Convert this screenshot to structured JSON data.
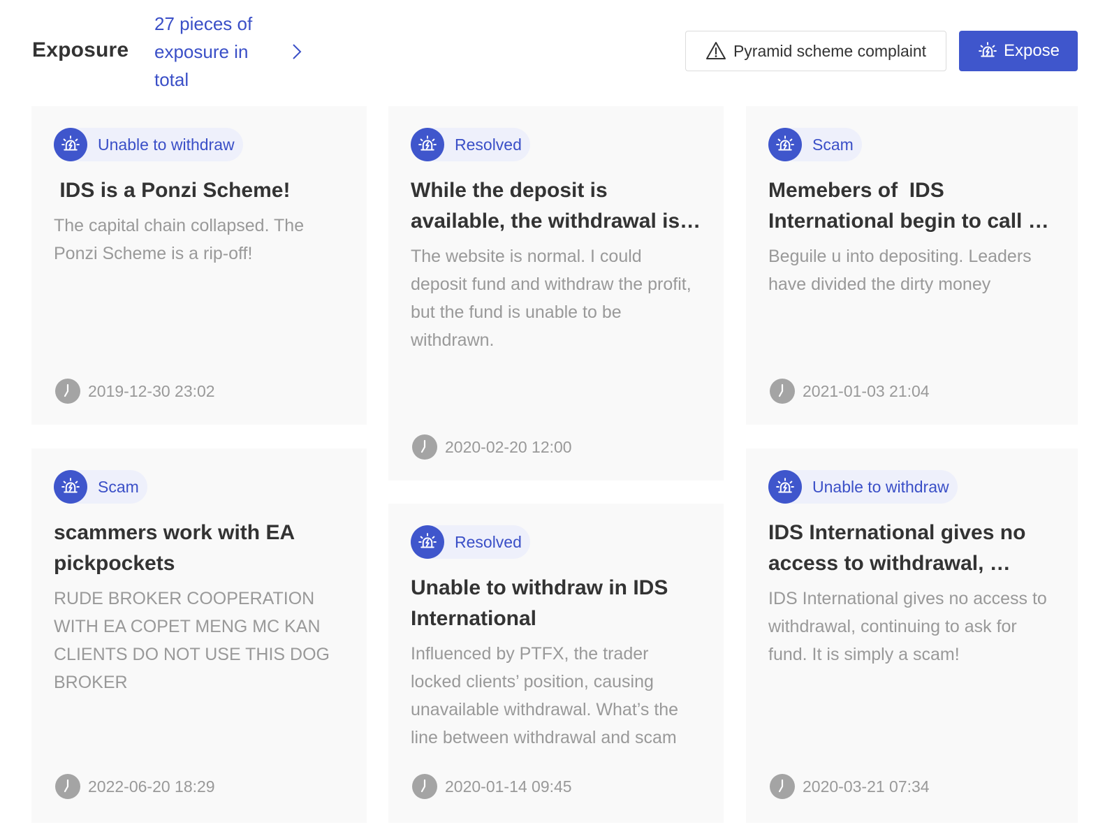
{
  "header": {
    "title": "Exposure",
    "count_text": "27 pieces of exposure in total",
    "complaint_label": "Pyramid scheme complaint",
    "expose_label": "Expose"
  },
  "colors": {
    "accent": "#3f56cc",
    "tag_background": "#eef0fb",
    "card_background": "#f9f9f9",
    "title_text": "#333333",
    "muted_text": "#999999"
  },
  "icons": {
    "tag": "alarm-siren-icon",
    "complaint": "warning-triangle-icon",
    "expose": "alarm-siren-icon",
    "time": "clock-icon",
    "more": "chevron-right-icon"
  },
  "cards": [
    {
      "tag": "Unable to withdraw",
      "title": " IDS is a Ponzi Scheme!",
      "description": "The capital chain collapsed. The Ponzi Scheme is a rip-off!",
      "time": "2019-12-30 23:02"
    },
    {
      "tag": "Resolved",
      "title": "While the deposit is available, the withdrawal is not",
      "description": "The website is normal. I could deposit fund and withdraw the profit, but the fund is unable to be withdrawn.",
      "time": "2020-02-20 12:00"
    },
    {
      "tag": "Scam",
      "title": "Memebers of  IDS International begin to call you",
      "description": "Beguile u into depositing. Leaders have divided the dirty money",
      "time": "2021-01-03 21:04"
    },
    {
      "tag": "Scam",
      "title": "scammers work with EA pickpockets",
      "description": "RUDE BROKER COOPERATION WITH EA COPET MENG MC KAN CLIENTS DO NOT USE THIS DOG BROKER",
      "time": "2022-06-20 18:29"
    },
    {
      "tag": "Resolved",
      "title": "Unable to withdraw in IDS International",
      "description": "Influenced by PTFX, the trader locked clients’ position, causing unavailable withdrawal. What’s the line between withdrawal and scam",
      "time": "2020-01-14 09:45"
    },
    {
      "tag": "Unable to withdraw",
      "title": "IDS International gives no access to withdrawal, continuing",
      "description": "IDS International gives no access to withdrawal, continuing to ask for fund. It is simply a scam!",
      "time": "2020-03-21 07:34"
    }
  ]
}
